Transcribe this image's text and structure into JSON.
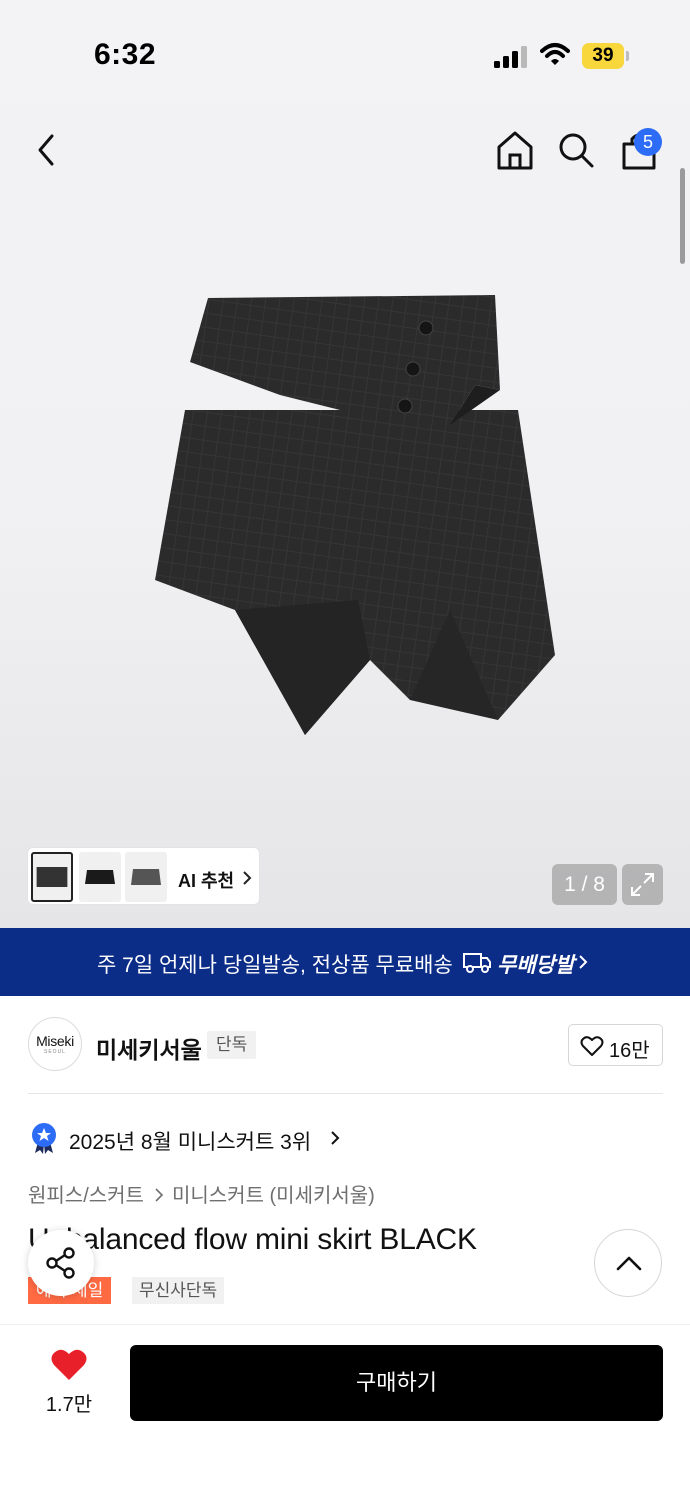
{
  "status_bar": {
    "time": "6:32",
    "battery": "39"
  },
  "nav": {
    "cart_count": "5"
  },
  "gallery": {
    "ai_label": "AI 추천",
    "pager": "1 / 8"
  },
  "banner": {
    "text": "주 7일 언제나 당일발송, 전상품 무료배송",
    "brand": "무배당발"
  },
  "brand": {
    "logo_text": "Miseki",
    "logo_sub": "SEOUL",
    "name": "미세키서울",
    "tag": "단독",
    "likes": "16만"
  },
  "ranking": {
    "text": "2025년 8월 미니스커트 3위"
  },
  "breadcrumb": [
    "원피스/스커트",
    "미니스커트 (미세키서울)"
  ],
  "product": {
    "title": "Unbalanced flow mini skirt BLACK",
    "tags": [
      "예약 세일",
      "무신사단독"
    ]
  },
  "bottom": {
    "wish_count": "1.7만",
    "buy_label": "구매하기"
  },
  "colors": {
    "banner_bg": "#0b2c87",
    "badge_blue": "#2d6cf6",
    "sale_tag": "#ff6a43",
    "wish_heart": "#e8202a",
    "battery": "#f7d73b"
  }
}
